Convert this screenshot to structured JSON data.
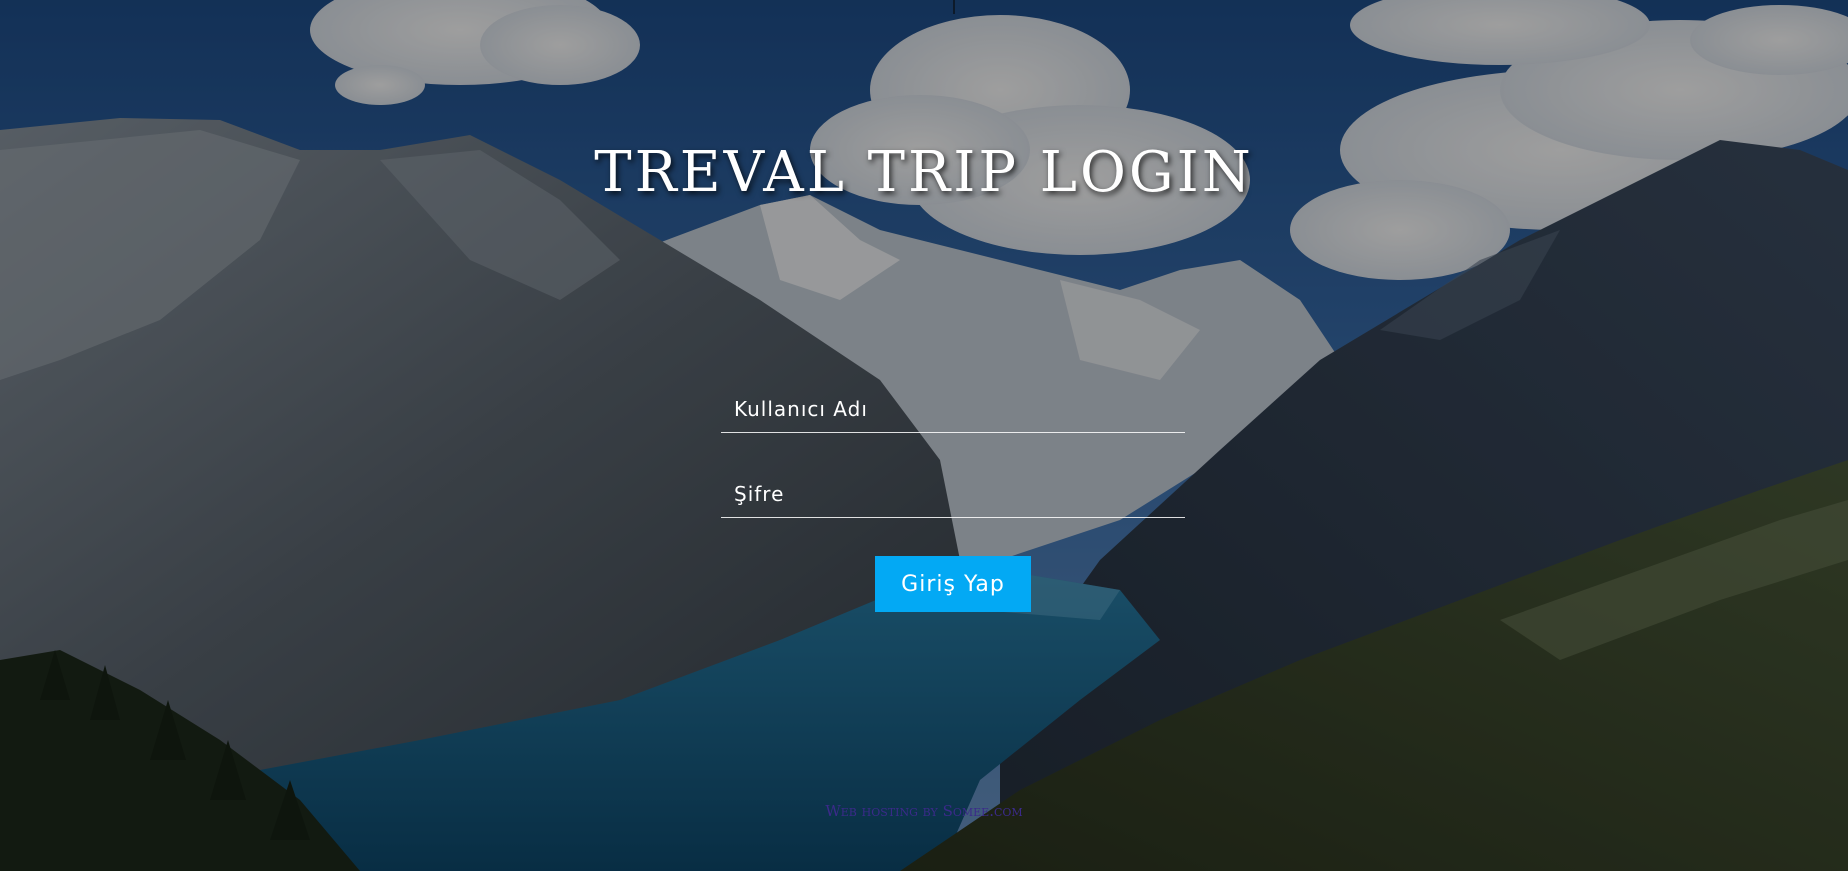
{
  "page": {
    "title": "TREVAL TRIP LOGIN"
  },
  "form": {
    "username_placeholder": "Kullanıcı Adı",
    "password_placeholder": "Şifre",
    "submit_label": "Giriş Yap"
  },
  "footer": {
    "text": "Web hosting by Somee.com"
  },
  "colors": {
    "button": "#03a9f4",
    "title": "#ffffff",
    "footer": "#3b2a8a"
  },
  "background": {
    "description_icon": "mountain-lake-landscape"
  }
}
